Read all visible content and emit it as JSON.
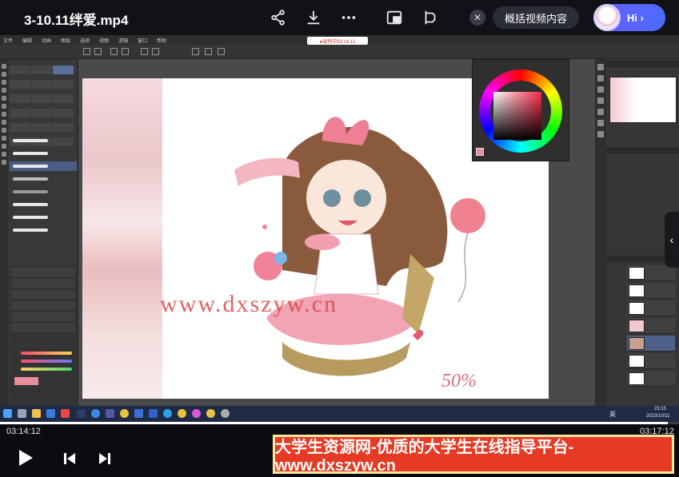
{
  "player": {
    "title": "3-10.11绊爱.mp4",
    "summary_label": "概括视频内容",
    "hi_label": "Hi ›",
    "close_symbol": "✕",
    "current_time": "03:14:12",
    "total_time": "03:17:12",
    "progress_fraction": 0.984
  },
  "screen": {
    "recording_text": "●录制中33:14:12",
    "canvas_watermark": "www.dxszyw.cn",
    "canvas_percent": "50%",
    "menu_items": [
      "文件",
      "编辑",
      "动画",
      "图层",
      "选择",
      "视图",
      "滤镜",
      "窗口",
      "帮助"
    ],
    "taskbar_ime": "英",
    "taskbar_time": "23:15",
    "taskbar_date": "2023/10/11"
  },
  "banner": {
    "text": "大学生资源网-优质的大学生在线指导平台-www.dxszyw.cn"
  },
  "colors": {
    "accent": "#e53a24",
    "banner_border": "#ffe6a0",
    "hi_gradient_start": "#6b5cff",
    "hi_gradient_end": "#4b6bff"
  },
  "icons": {
    "share": "share-icon",
    "download": "download-icon",
    "more": "more-icon",
    "pip": "picture-in-picture-icon",
    "fullscreen": "fullscreen-icon",
    "play": "play-icon",
    "prev": "previous-icon",
    "next": "next-icon"
  }
}
